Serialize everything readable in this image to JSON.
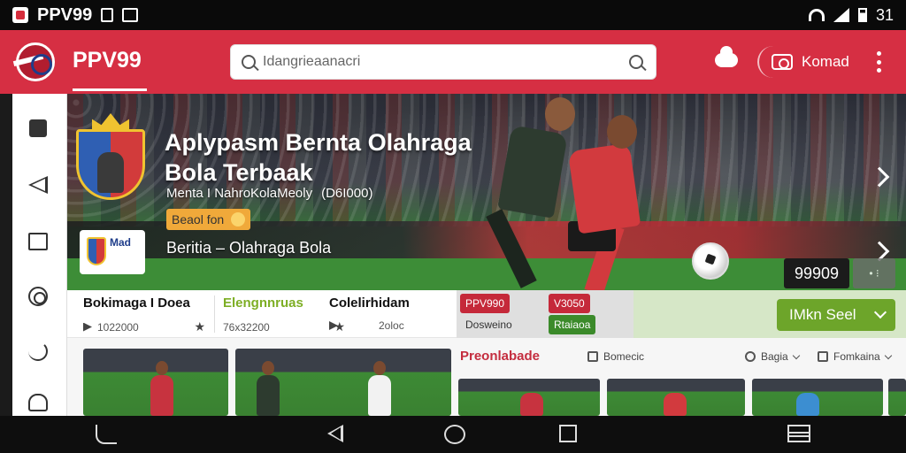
{
  "status_bar": {
    "app_name": "PPV99",
    "time": "31"
  },
  "header": {
    "brand": "PPV99",
    "search": {
      "value": "Idangrieaanacri",
      "placeholder": "Idangrieaanacri"
    },
    "contact_label": "Komad"
  },
  "hero": {
    "title": "Aplypasm Bernta Olahraga Bola Terbaak",
    "meta_author": "Menta I NahroKolaMeoly",
    "meta_count": "(D6I000)",
    "tag": "Beaol fon",
    "mini_crest_text": "Mad",
    "subtitle": "Beritia – Olahraga Bola",
    "score": "99909",
    "share": "•  ⁝"
  },
  "info": [
    {
      "title": "Bokimaga I Doea",
      "stat": "1022000"
    },
    {
      "title": "Elengnnruas",
      "stat": "76x32200"
    },
    {
      "title": "Colelirhidam",
      "stat": "2oloc"
    }
  ],
  "chips": [
    {
      "label": "PPV990",
      "style": "red"
    },
    {
      "label": "V3050",
      "style": "red"
    },
    {
      "label": "Dosweino",
      "style": "plain"
    },
    {
      "label": "Rtaiaoa",
      "style": "green"
    }
  ],
  "cta": {
    "label": "IMkn Seel"
  },
  "lower": {
    "section_title": "Preonlabade",
    "filters": [
      {
        "label": "Bomecic"
      },
      {
        "label": "Bagia"
      },
      {
        "label": "Fomkaina"
      }
    ]
  },
  "colors": {
    "brand_red": "#d62f43",
    "accent_orange": "#f0a93a",
    "accent_green": "#6da52a"
  }
}
